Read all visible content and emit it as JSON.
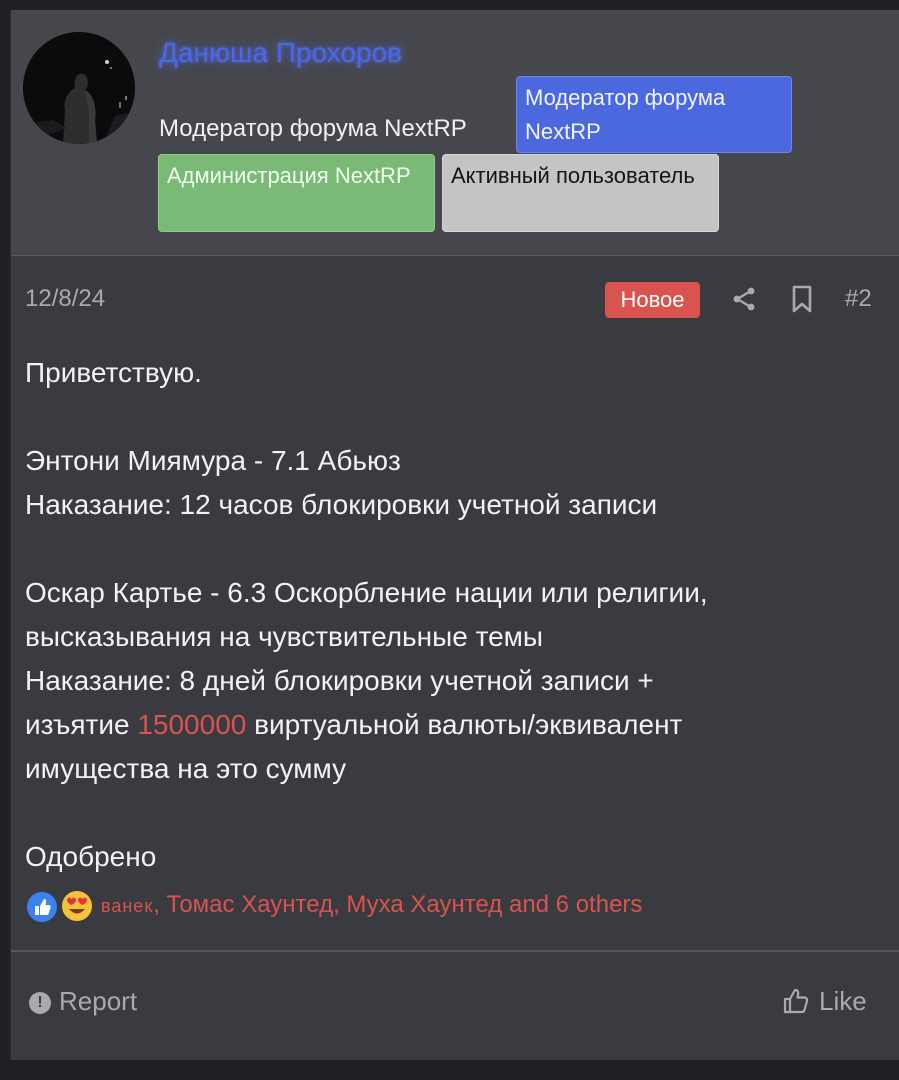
{
  "user": {
    "name": "Данюша Прохоров",
    "title": "Модератор форума NextRP",
    "badges": [
      {
        "label": "Модератор форума NextRP",
        "color": "#4c68de"
      },
      {
        "label": "Администрация NextRP",
        "color": "#7ab976"
      },
      {
        "label": "Активный пользователь",
        "color": "#c4c4c4"
      }
    ]
  },
  "post": {
    "date": "12/8/24",
    "new_label": "Новое",
    "number": "#2",
    "greeting": "Приветствую.",
    "line1": "Энтони Миямура - 7.1 Абьюз",
    "line2": "Наказание: 12 часов блокировки учетной записи",
    "line3": "Оскар Картье - 6.3 Оскорбление нации или религии,",
    "line4": "высказывания на чувствительные темы",
    "line5": "Наказание: 8 дней блокировки учетной записи +",
    "line6_before": "изъятие ",
    "line6_amount": "1500000",
    "line6_after": " виртуальной валюты/эквивалент",
    "line7": "имущества на это сумму",
    "verdict": "Одобрено"
  },
  "reactions": {
    "first_user": "ванек",
    "rest": ", Томас Хаунтед, Муха Хаунтед and 6 others"
  },
  "footer": {
    "report_label": "Report",
    "like_label": "Like"
  },
  "colors": {
    "accent_red": "#d9534f",
    "username_blue": "#4c67e6"
  }
}
